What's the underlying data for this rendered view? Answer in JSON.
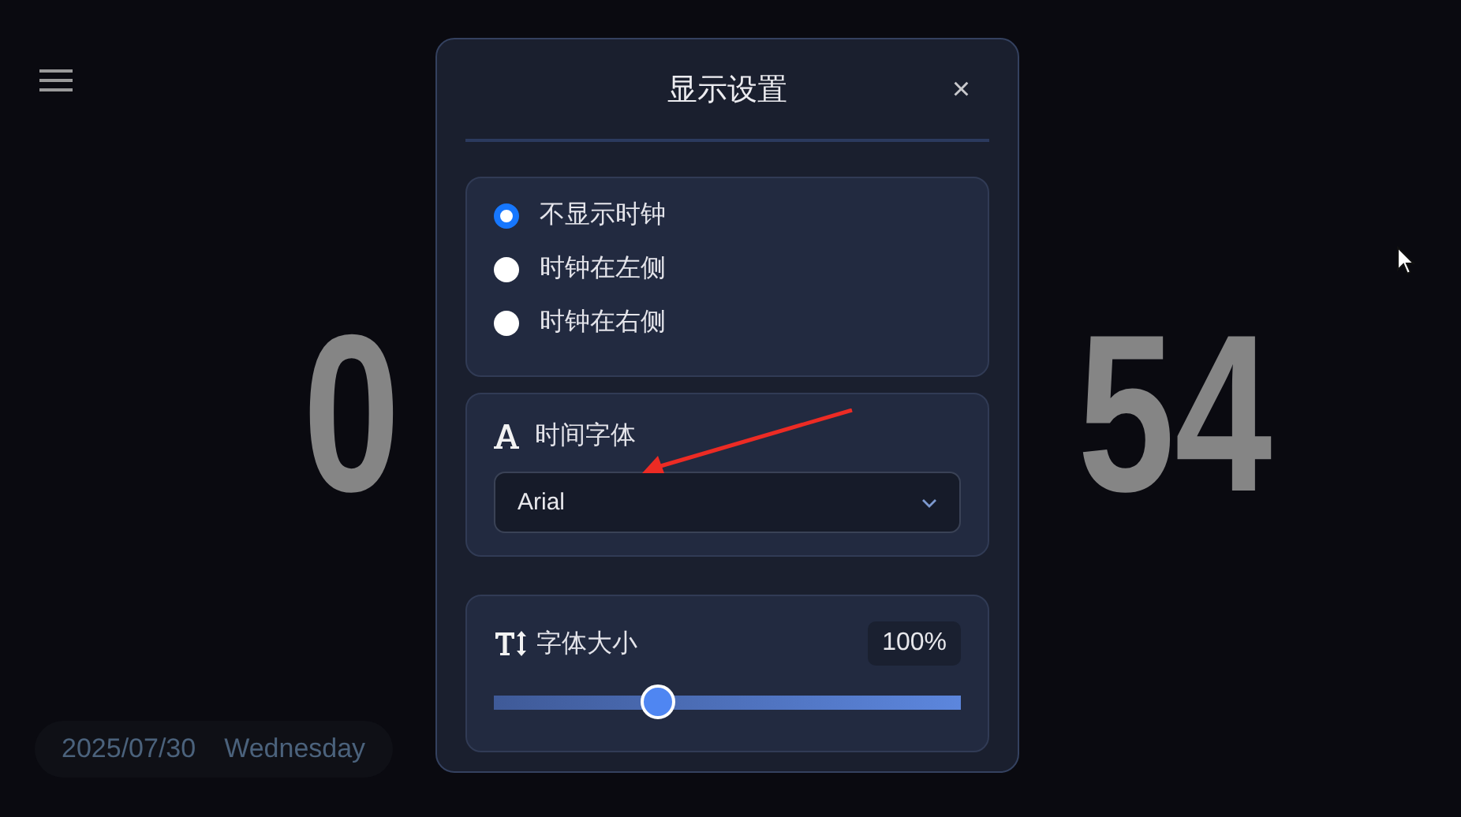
{
  "clock": {
    "left_digits": "0",
    "right_digits": "54"
  },
  "date_bar": {
    "date": "2025/07/30",
    "weekday": "Wednesday"
  },
  "dialog": {
    "title": "显示设置",
    "close": "×",
    "clock_position": {
      "options": [
        {
          "label": "不显示时钟",
          "selected": true
        },
        {
          "label": "时钟在左侧",
          "selected": false
        },
        {
          "label": "时钟在右侧",
          "selected": false
        }
      ]
    },
    "font": {
      "label": "时间字体",
      "value": "Arial"
    },
    "font_size": {
      "label": "字体大小",
      "value": "100%",
      "level": 0.35
    }
  }
}
